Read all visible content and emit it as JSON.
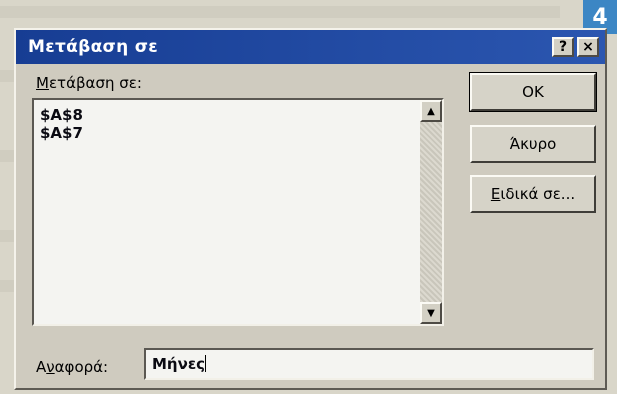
{
  "page_badge": "4",
  "dialog": {
    "title": "Μετάβαση σε",
    "title_buttons": {
      "help": "?",
      "close": "×"
    },
    "goto_label_prefix": "Μ",
    "goto_label_rest": "ετάβαση σε:",
    "goto_list": [
      "$A$8",
      "$A$7"
    ],
    "buttons": {
      "ok": "OK",
      "cancel": "Άκυρο",
      "special_prefix": "Ε",
      "special_rest": "ιδικά σε..."
    },
    "reference_label_prefix": "Α",
    "reference_label_mid": "ν",
    "reference_label_rest": "αφορά:",
    "reference_value": "Μήνες"
  }
}
